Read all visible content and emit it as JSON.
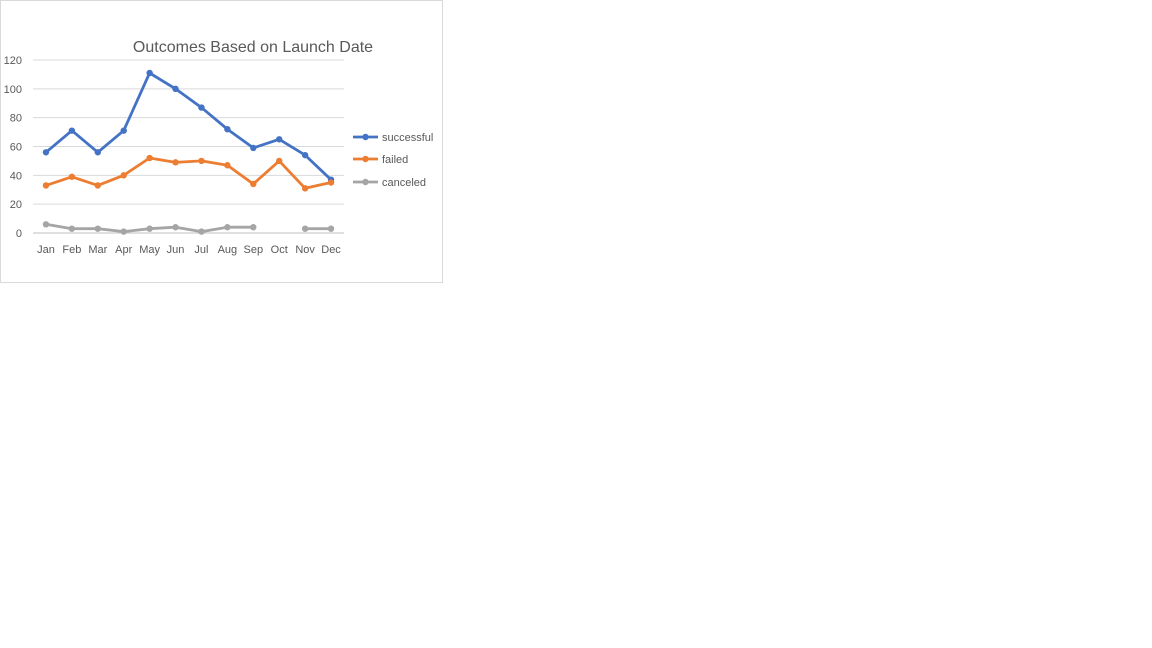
{
  "chart_data": {
    "type": "line",
    "title": "Outcomes Based on Launch Date",
    "xlabel": "",
    "ylabel": "",
    "ylim": [
      0,
      120
    ],
    "yticks": [
      0,
      20,
      40,
      60,
      80,
      100,
      120
    ],
    "grid": true,
    "legend": "right",
    "categories": [
      "Jan",
      "Feb",
      "Mar",
      "Apr",
      "May",
      "Jun",
      "Jul",
      "Aug",
      "Sep",
      "Oct",
      "Nov",
      "Dec"
    ],
    "series": [
      {
        "name": "successful",
        "color": "#4472c4",
        "values": [
          56,
          71,
          56,
          71,
          111,
          100,
          87,
          72,
          59,
          65,
          54,
          37
        ]
      },
      {
        "name": "failed",
        "color": "#ed7d31",
        "values": [
          33,
          39,
          33,
          40,
          52,
          49,
          50,
          47,
          34,
          50,
          31,
          35
        ]
      },
      {
        "name": "canceled",
        "color": "#a5a5a5",
        "values": [
          6,
          3,
          3,
          1,
          3,
          4,
          1,
          4,
          4,
          null,
          3,
          3
        ]
      }
    ]
  }
}
